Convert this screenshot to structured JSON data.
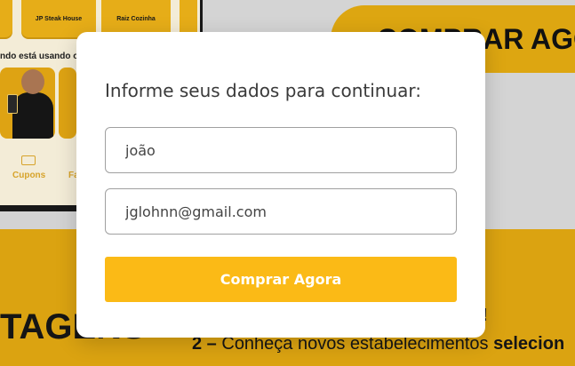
{
  "background": {
    "pill_heading": "COMPRAR AGORA",
    "phone": {
      "cards": [
        "JP Steak House",
        "Raiz Cozinha"
      ],
      "promo_text": "ndo está usando o",
      "nav": {
        "cupons_label": "Cupons",
        "other_label": "Fa"
      }
    },
    "big_heading": "TAGENS",
    "line1": "o!",
    "line2_prefix": "2 –",
    "line2_text": " Conheça novos estabelecimentos ",
    "line2_bold": "selecion"
  },
  "modal": {
    "title": "Informe seus dados para continuar:",
    "name_field": {
      "value": "joão"
    },
    "email_field": {
      "value": "jglohnn@gmail.com"
    },
    "submit_label": "Comprar Agora"
  },
  "colors": {
    "accent": "#fbba16",
    "background_yellow": "#e4aa12"
  }
}
